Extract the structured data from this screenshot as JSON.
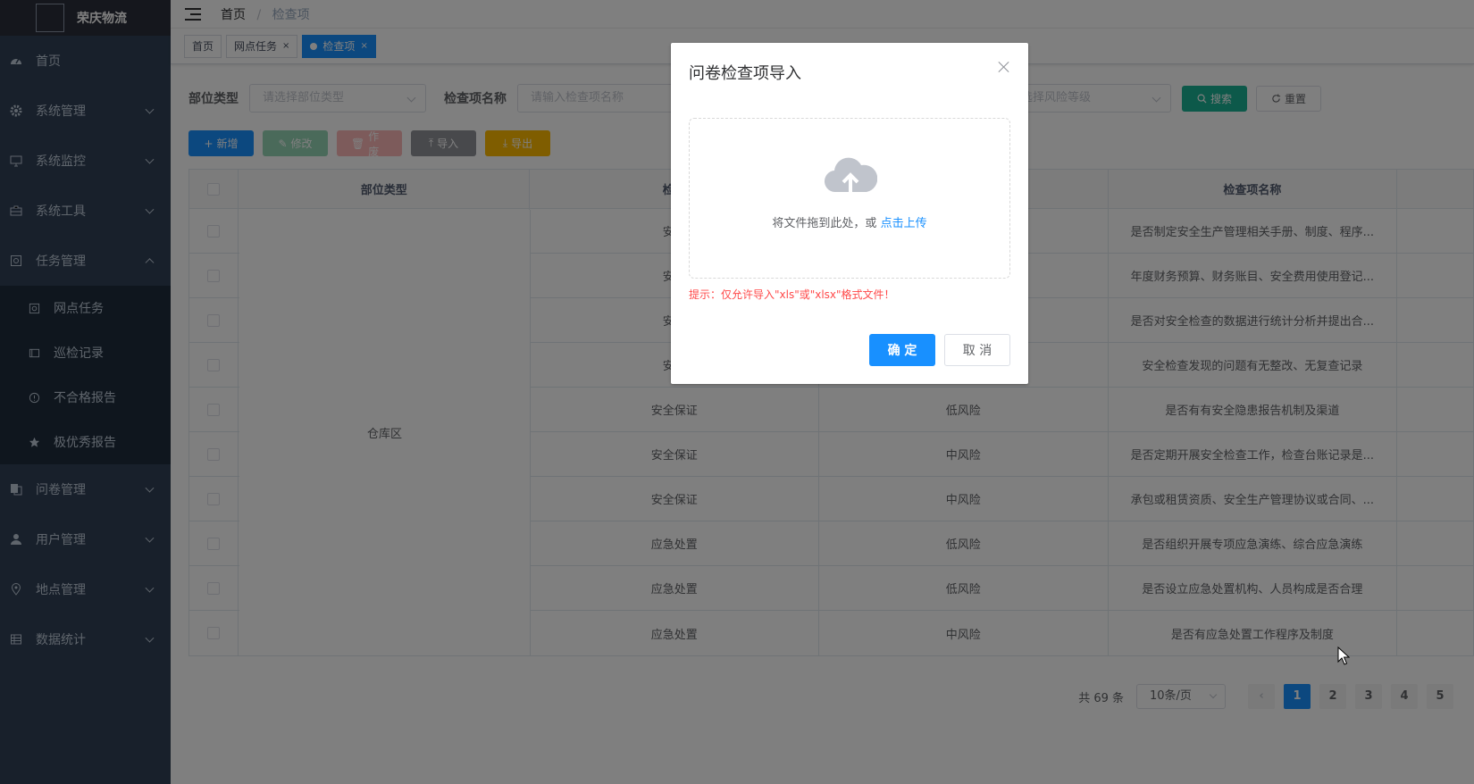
{
  "app": {
    "title": "荣庆物流"
  },
  "sidebar": {
    "items": [
      {
        "label": "首页",
        "icon": "dashboard-icon"
      },
      {
        "label": "系统管理",
        "icon": "gear-icon"
      },
      {
        "label": "系统监控",
        "icon": "monitor-icon"
      },
      {
        "label": "系统工具",
        "icon": "toolbox-icon"
      },
      {
        "label": "任务管理",
        "icon": "task-icon"
      }
    ],
    "subitems": [
      {
        "label": "网点任务",
        "icon": "job-icon"
      },
      {
        "label": "巡检记录",
        "icon": "record-icon"
      },
      {
        "label": "不合格报告",
        "icon": "warning-icon"
      },
      {
        "label": "极优秀报告",
        "icon": "star-icon"
      }
    ],
    "items_after": [
      {
        "label": "问卷管理",
        "icon": "documents-icon"
      },
      {
        "label": "用户管理",
        "icon": "user-icon"
      },
      {
        "label": "地点管理",
        "icon": "location-icon"
      },
      {
        "label": "数据统计",
        "icon": "table-icon"
      }
    ]
  },
  "breadcrumb": {
    "home": "首页",
    "sep": "/",
    "current": "检查项"
  },
  "tags": [
    {
      "label": "首页"
    },
    {
      "label": "网点任务",
      "close": "×"
    },
    {
      "label": "检查项",
      "close": "×"
    }
  ],
  "search": {
    "label_part": "部位类型",
    "placeholder_part": "请选择部位类型",
    "label_name": "检查项名称",
    "placeholder_name": "请输入检查项名称",
    "placeholder_risk": "请选择风险等级",
    "search_btn": "搜索",
    "reset_btn": "重置"
  },
  "toolbar": {
    "add": "新增",
    "edit": "修改",
    "del": "作废",
    "import": "导入",
    "export": "导出"
  },
  "table": {
    "headers": [
      "部位类型",
      "检查",
      "",
      "检查项名称"
    ],
    "merged_part": "仓库区",
    "rows": [
      {
        "cat": "安全",
        "risk": "",
        "name": "是否制定安全生产管理相关手册、制度、程序..."
      },
      {
        "cat": "安全",
        "risk": "",
        "name": "年度财务预算、财务账目、安全费用使用登记..."
      },
      {
        "cat": "安全",
        "risk": "",
        "name": "是否对安全检查的数据进行统计分析并提出合..."
      },
      {
        "cat": "安全",
        "risk": "",
        "name": "安全检查发现的问题有无整改、无复查记录"
      },
      {
        "cat": "安全保证",
        "risk": "低风险",
        "name": "是否有有安全隐患报告机制及渠道"
      },
      {
        "cat": "安全保证",
        "risk": "中风险",
        "name": "是否定期开展安全检查工作，检查台账记录是..."
      },
      {
        "cat": "安全保证",
        "risk": "中风险",
        "name": "承包或租赁资质、安全生产管理协议或合同、..."
      },
      {
        "cat": "应急处置",
        "risk": "低风险",
        "name": "是否组织开展专项应急演练、综合应急演练"
      },
      {
        "cat": "应急处置",
        "risk": "低风险",
        "name": "是否设立应急处置机构、人员构成是否合理"
      },
      {
        "cat": "应急处置",
        "risk": "中风险",
        "name": "是否有应急处置工作程序及制度"
      }
    ]
  },
  "pagination": {
    "total": "共 69 条",
    "size": "10条/页",
    "pages": [
      "1",
      "2",
      "3",
      "4",
      "5"
    ],
    "prev": "‹"
  },
  "dialog": {
    "title": "问卷检查项导入",
    "drag_text": "将文件拖到此处，或",
    "click_upload": "点击上传",
    "tip": "提示：仅允许导入\"xls\"或\"xlsx\"格式文件！",
    "ok": "确 定",
    "cancel": "取 消"
  },
  "colors": {
    "sidebar_bg": "#304156",
    "primary": "#1890ff",
    "search_btn": "#1ab394"
  }
}
